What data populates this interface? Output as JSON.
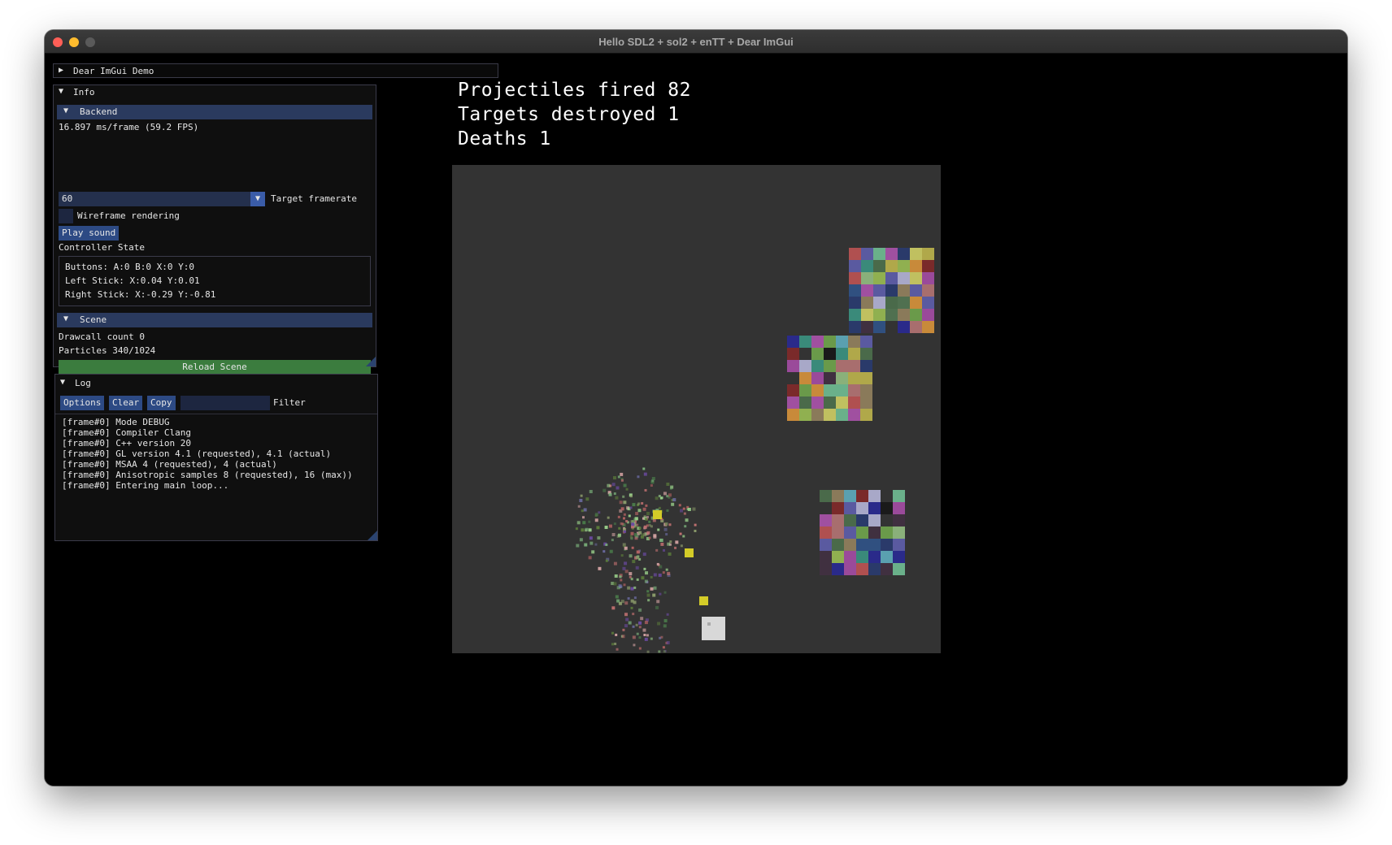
{
  "window": {
    "title": "Hello SDL2 + sol2 + enTT + Dear ImGui"
  },
  "demo_window": {
    "arrow": "▶",
    "title": "Dear ImGui Demo"
  },
  "info": {
    "arrow": "▼",
    "title": "Info",
    "backend": {
      "arrow": "▼",
      "title": "Backend",
      "frame_stats": "16.897 ms/frame (59.2 FPS)",
      "framerate_value": "60",
      "framerate_arrow": "▼",
      "framerate_label": "Target framerate",
      "wireframe_label": "Wireframe rendering",
      "wireframe_checked": false,
      "play_sound_label": "Play sound",
      "controller_state_label": "Controller State",
      "controller_lines": [
        "Buttons: A:0 B:0 X:0 Y:0",
        "Left Stick: X:0.04 Y:0.01",
        "Right Stick: X:-0.29 Y:-0.81"
      ]
    },
    "scene": {
      "arrow": "▼",
      "title": "Scene",
      "drawcall": "Drawcall count 0",
      "particles": "Particles 340/1024",
      "reload_label": "Reload Scene"
    }
  },
  "log": {
    "arrow": "▼",
    "title": "Log",
    "options_label": "Options",
    "clear_label": "Clear",
    "copy_label": "Copy",
    "filter_value": "",
    "filter_label": "Filter",
    "lines": [
      "[frame#0] Mode DEBUG",
      "[frame#0] Compiler Clang",
      "[frame#0] C++ version 20",
      "[frame#0] GL version 4.1 (requested), 4.1 (actual)",
      "[frame#0] MSAA 4 (requested), 4 (actual)",
      "[frame#0] Anisotropic samples 8 (requested), 16 (max))",
      "[frame#0] Entering main loop..."
    ]
  },
  "hud": {
    "projectiles": "Projectiles fired 82",
    "targets": "Targets destroyed 1",
    "deaths": "Deaths 1"
  },
  "game": {
    "background": "#333333",
    "player_color": "#d8d8d8",
    "projectile_color": "#d4cc28",
    "target_palette": [
      "#6a9a4a",
      "#b0a84a",
      "#a86e6e",
      "#3a8a7a",
      "#7a2a2a",
      "#5a5aa0",
      "#8ab07a",
      "#a8a8c8",
      "#9a4a9a",
      "#2a3a6a",
      "#c88a3a",
      "#4a6a4a",
      "#6ab08a",
      "#b05050",
      "#2a2a8a",
      "#8a7a5a",
      "#5aa0b0",
      "#403040",
      "#c0c060",
      "#1a1a1a",
      "#507050",
      "#a050a0",
      "#305080",
      "#90b050"
    ],
    "particle_palette": [
      "#7ab07a",
      "#9ad08a",
      "#c07070",
      "#6a4aa0",
      "#5a7a3a",
      "#b06060",
      "#d0a0a0",
      "#4a7a4a",
      "#6a6aa0",
      "#8a9a6a"
    ]
  }
}
